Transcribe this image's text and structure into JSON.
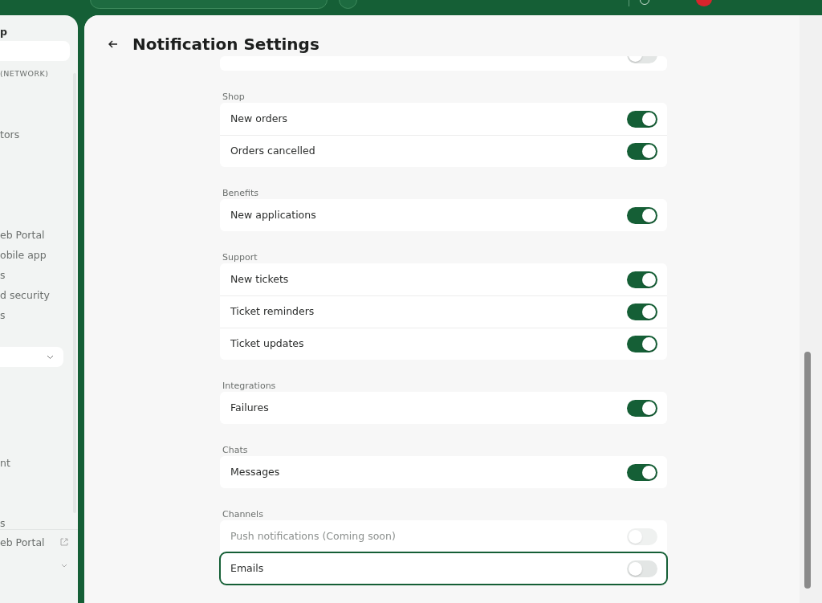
{
  "sidebar": {
    "items": [
      {
        "kind": "heading",
        "label": "p"
      },
      {
        "kind": "search"
      },
      {
        "kind": "section",
        "label": "(NETWORK)"
      },
      {
        "kind": "item",
        "label": "tors"
      },
      {
        "kind": "item",
        "label": "eb Portal"
      },
      {
        "kind": "item",
        "label": "obile app"
      },
      {
        "kind": "item",
        "label": "s"
      },
      {
        "kind": "item",
        "label": "d security"
      },
      {
        "kind": "item",
        "label": "s"
      },
      {
        "kind": "select"
      },
      {
        "kind": "item",
        "label": "nt"
      },
      {
        "kind": "item",
        "label": "s"
      },
      {
        "kind": "link",
        "label": "eb Portal"
      },
      {
        "kind": "collapse"
      }
    ]
  },
  "page": {
    "title": "Notification Settings"
  },
  "sections": [
    {
      "rows": [
        {
          "checked": false,
          "disabled": false,
          "focused": false
        }
      ]
    },
    {
      "label": "Shop",
      "rows": [
        {
          "label": "New orders",
          "checked": true,
          "disabled": false,
          "focused": false
        },
        {
          "label": "Orders cancelled",
          "checked": true,
          "disabled": false,
          "focused": false
        }
      ]
    },
    {
      "label": "Benefits",
      "rows": [
        {
          "label": "New applications",
          "checked": true,
          "disabled": false,
          "focused": false
        }
      ]
    },
    {
      "label": "Support",
      "rows": [
        {
          "label": "New tickets",
          "checked": true,
          "disabled": false,
          "focused": false
        },
        {
          "label": "Ticket reminders",
          "checked": true,
          "disabled": false,
          "focused": false
        },
        {
          "label": "Ticket updates",
          "checked": true,
          "disabled": false,
          "focused": false
        }
      ]
    },
    {
      "label": "Integrations",
      "rows": [
        {
          "label": "Failures",
          "checked": true,
          "disabled": false,
          "focused": false
        }
      ]
    },
    {
      "label": "Chats",
      "rows": [
        {
          "label": "Messages",
          "checked": true,
          "disabled": false,
          "focused": false
        }
      ]
    },
    {
      "label": "Channels",
      "rows": [
        {
          "label": "Push notifications (Coming soon)",
          "checked": false,
          "disabled": true,
          "focused": false
        },
        {
          "label": "Emails",
          "checked": false,
          "disabled": false,
          "focused": true
        }
      ]
    }
  ]
}
